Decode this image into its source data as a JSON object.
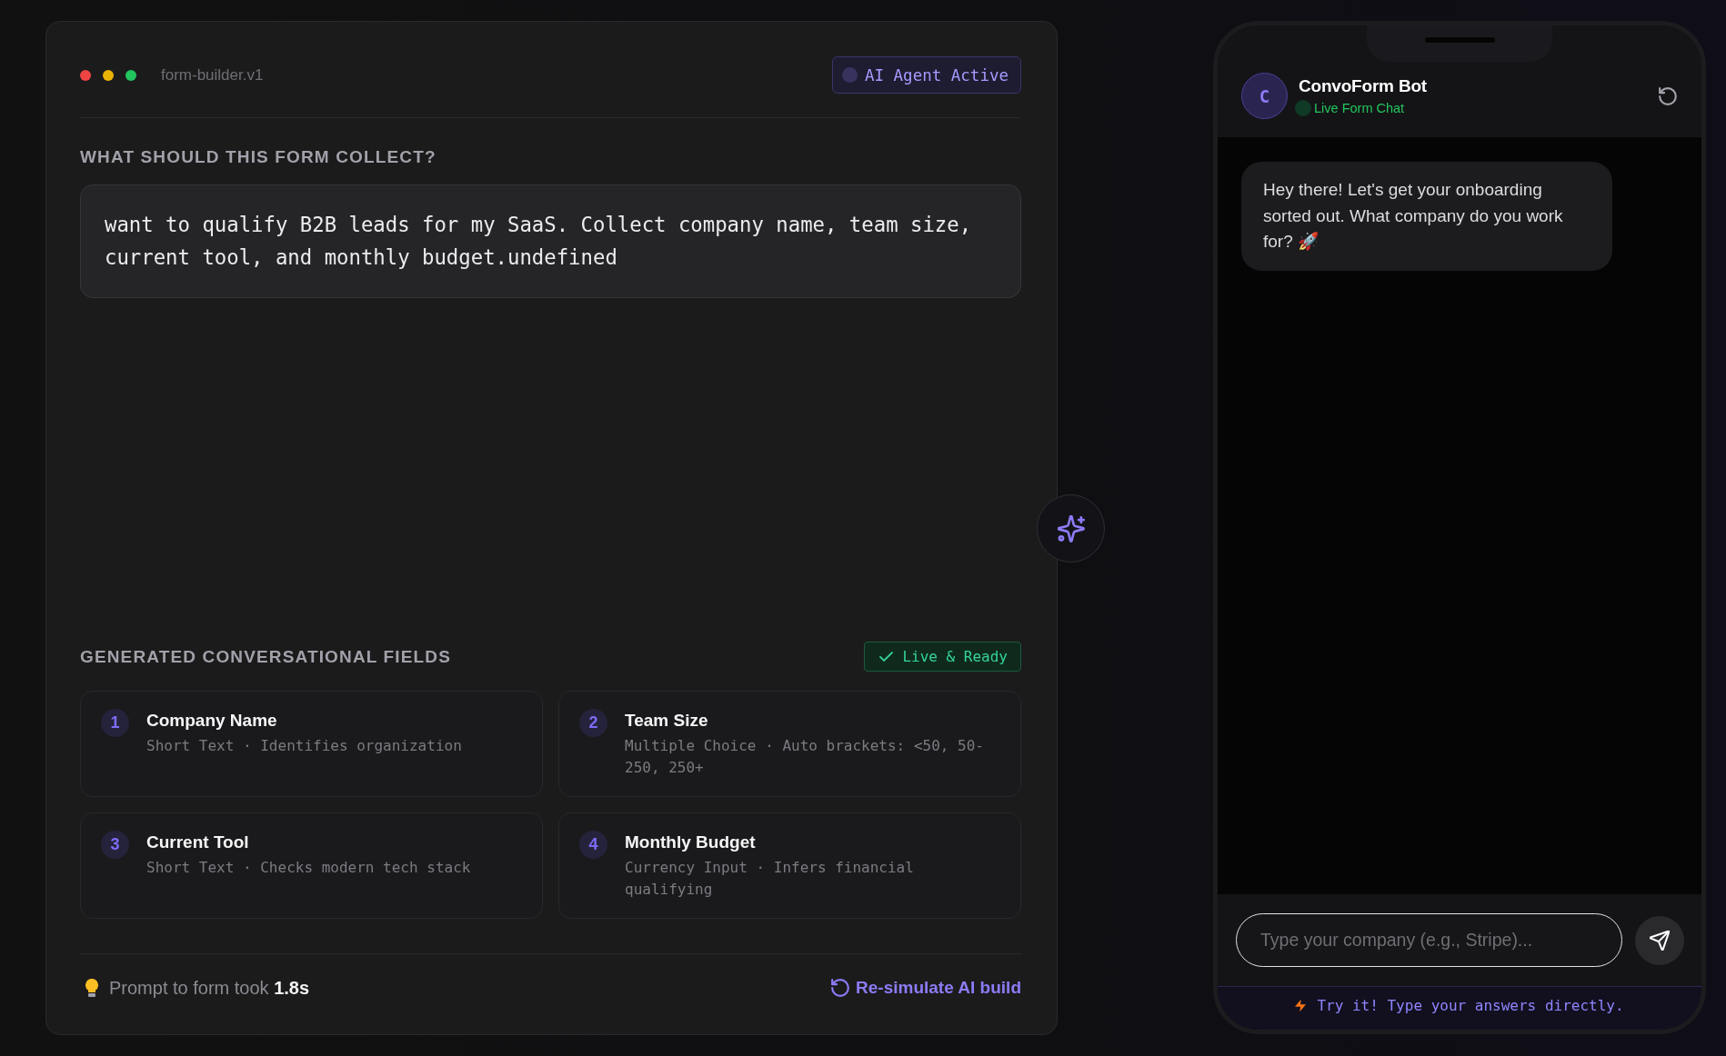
{
  "window": {
    "title": "form-builder.v1",
    "dots": [
      {
        "color": "#ef4444"
      },
      {
        "color": "#eab308"
      },
      {
        "color": "#22c55e"
      }
    ],
    "badge": "AI Agent Active"
  },
  "prompt": {
    "label": "WHAT SHOULD THIS FORM COLLECT?",
    "value": "want to qualify B2B leads for my SaaS. Collect company name, team size, current tool, and monthly budget.undefined"
  },
  "fields_section": {
    "title": "GENERATED CONVERSATIONAL FIELDS",
    "badge": "Live & Ready",
    "fields": [
      {
        "number": "1",
        "name": "Company Name",
        "meta": "Short Text · Identifies organization"
      },
      {
        "number": "2",
        "name": "Team Size",
        "meta": "Multiple Choice · Auto brackets: <50, 50-250, 250+"
      },
      {
        "number": "3",
        "name": "Current Tool",
        "meta": "Short Text · Checks modern tech stack"
      },
      {
        "number": "4",
        "name": "Monthly Budget",
        "meta": "Currency Input · Infers financial qualifying"
      }
    ]
  },
  "footer": {
    "note": "Prompt to form took **1.8s**",
    "action": "Re-simulate AI build"
  },
  "chat": {
    "avatar": "C",
    "bot_name": "ConvoForm Bot",
    "status": "Live Form Chat",
    "messages": [
      {
        "text": "Hey there! Let's get your onboarding sorted out. What company do you work for? 🚀"
      }
    ],
    "input": {
      "placeholder": "Type your company (e.g., Stripe)..."
    },
    "hint": "Try it! Type your answers directly."
  }
}
